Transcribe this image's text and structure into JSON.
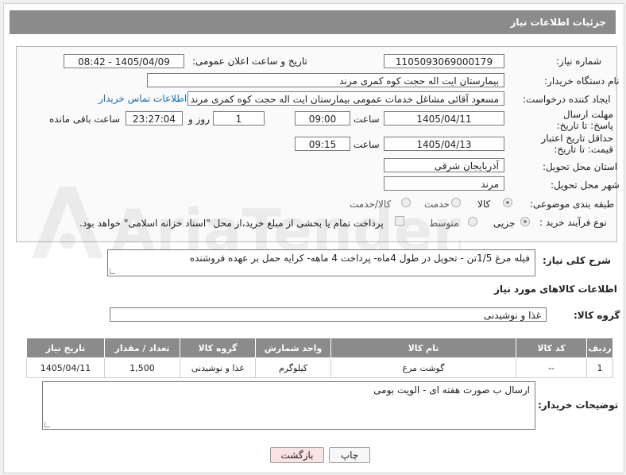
{
  "header": {
    "title": "جزئیات اطلاعات نیاز"
  },
  "fields": {
    "need_number_label": "شماره نیاز:",
    "need_number": "1105093069000179",
    "announce_label": "تاریخ و ساعت اعلان عمومی:",
    "announce_value": "1405/04/09 - 08:42",
    "buyer_org_label": "نام دستگاه خریدار:",
    "buyer_org": "بیمارستان ایت اله حجت کوه کمری مرند",
    "creator_label": "ایجاد کننده درخواست:",
    "creator": "مسعود آقائی مشاغل خدمات عمومی بیمارستان ایت اله حجت کوه کمری مرند",
    "contact_link": "اطلاعات تماس خریدار",
    "reply_deadline_label": "مهلت ارسال پاسخ: تا تاریخ:",
    "reply_date": "1405/04/11",
    "time_label": "ساعت",
    "reply_time": "09:00",
    "days_value": "1",
    "days_label": "روز و",
    "remaining_time": "23:27:04",
    "remaining_label": "ساعت باقی مانده",
    "price_deadline_label": "حداقل تاریخ اعتبار قیمت: تا تاریخ:",
    "price_date": "1405/04/13",
    "price_time": "09:15",
    "province_label": "استان محل تحویل:",
    "province": "آذربایجان شرقی",
    "city_label": "شهر محل تحویل:",
    "city": "مرند",
    "category_label": "طبقه بندی موضوعی:",
    "category_options": [
      "کالا",
      "خدمت",
      "کالا/خدمت"
    ],
    "process_label": "نوع فرآیند خرید :",
    "process_options": [
      "جزیی",
      "متوسط"
    ],
    "payment_note": "پرداخت تمام یا بخشی از مبلغ خرید،از محل \"اسناد خزانه اسلامی\" خواهد بود."
  },
  "description": {
    "label": "شرح کلی نیاز:",
    "value": "فیله مرغ 1/5تن - تحویل در طول  4ماه- پرداخت 4 ماهه- کرایه حمل بر عهده فروشنده"
  },
  "goods": {
    "section_title": "اطلاعات کالاهای مورد نیاز",
    "group_label": "گروه کالا:",
    "group_value": "غذا و نوشیدنی",
    "columns": [
      "ردیف",
      "کد کالا",
      "نام کالا",
      "واحد شمارش",
      "گروه کالا",
      "تعداد / مقدار",
      "تاریخ نیاز"
    ],
    "rows": [
      [
        "1",
        "--",
        "گوشت مرغ",
        "کیلوگرم",
        "غذا و نوشیدنی",
        "1,500",
        "1405/04/11"
      ]
    ]
  },
  "buyer_notes": {
    "label": "توضیحات خریدار:",
    "value": "ارسال ب صورت هفته ای - الویت بومی"
  },
  "buttons": {
    "print": "چاپ",
    "back": "بازگشت"
  },
  "watermark": {
    "text": "AriaTender.net"
  },
  "colors": {
    "header_bg": "#8b8b8b",
    "link": "#1a6cb0",
    "back_button_bg": "#fbe3e3"
  }
}
